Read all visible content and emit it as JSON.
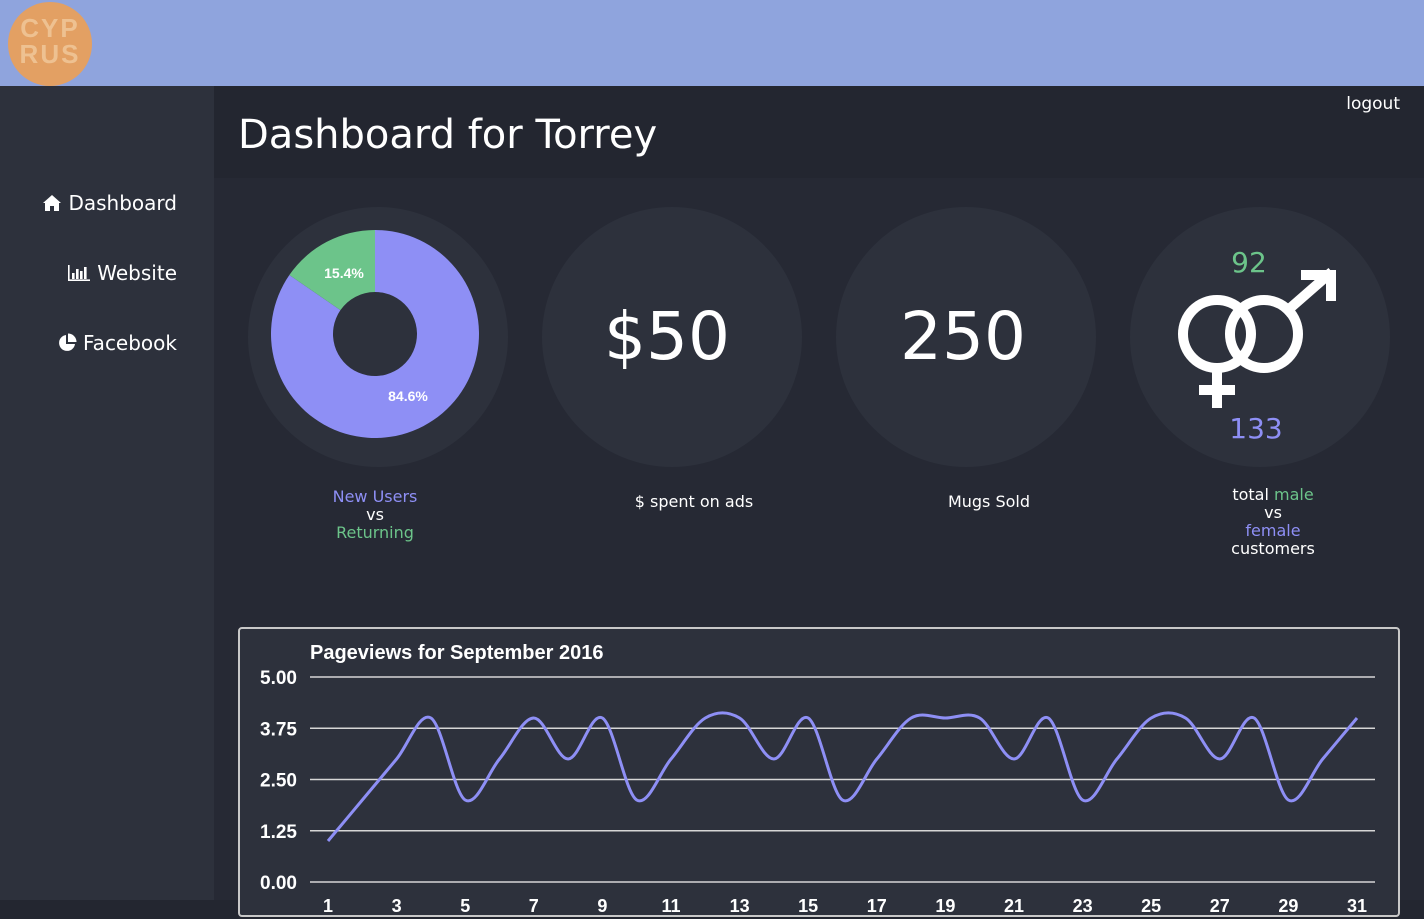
{
  "logo": {
    "line1": "CYP",
    "line2": "RUS"
  },
  "header": {
    "title": "Dashboard for Torrey",
    "logout_label": "logout"
  },
  "sidebar": {
    "items": [
      {
        "label": "Dashboard",
        "icon": "home-icon"
      },
      {
        "label": "Website",
        "icon": "bar-chart-icon"
      },
      {
        "label": "Facebook",
        "icon": "pie-chart-icon"
      }
    ]
  },
  "stats": {
    "users": {
      "new_pct": 84.6,
      "returning_pct": 15.4,
      "new_label": "84.6%",
      "returning_label": "15.4%",
      "caption_new": "New Users",
      "caption_vs": "vs",
      "caption_returning": "Returning"
    },
    "ads": {
      "value": "$50",
      "caption": "$ spent on ads"
    },
    "mugs": {
      "value": "250",
      "caption": "Mugs Sold"
    },
    "gender": {
      "male_count": "92",
      "female_count": "133",
      "caption_total": "total",
      "caption_male": "male",
      "caption_vs": "vs",
      "caption_female": "female",
      "caption_customers": "customers"
    }
  },
  "colors": {
    "topbar": "#8fa4dd",
    "accent_blue": "#8e8ff5",
    "accent_green": "#6cc48a",
    "line": "#8e8ff5",
    "logo": "#e3a063"
  },
  "chart_data": {
    "type": "line",
    "title": "Pageviews for September 2016",
    "x": [
      1,
      2,
      3,
      4,
      5,
      6,
      7,
      8,
      9,
      10,
      11,
      12,
      13,
      14,
      15,
      16,
      17,
      18,
      19,
      20,
      21,
      22,
      23,
      24,
      25,
      26,
      27,
      28,
      29,
      30,
      31
    ],
    "x_tick_labels": [
      "1",
      "3",
      "5",
      "7",
      "9",
      "11",
      "13",
      "15",
      "17",
      "19",
      "21",
      "23",
      "25",
      "27",
      "29",
      "31"
    ],
    "series": [
      {
        "values": [
          1,
          2,
          3,
          4,
          2,
          3,
          4,
          3,
          4,
          2,
          3,
          4,
          4,
          3,
          4,
          2,
          3,
          4,
          4,
          4,
          3,
          4,
          2,
          3,
          4,
          4,
          3,
          4,
          2,
          3,
          4
        ]
      }
    ],
    "y_ticks": [
      "5.00",
      "3.75",
      "2.50",
      "1.25",
      "0.00"
    ],
    "ylim": [
      0,
      5
    ],
    "grid": true
  }
}
